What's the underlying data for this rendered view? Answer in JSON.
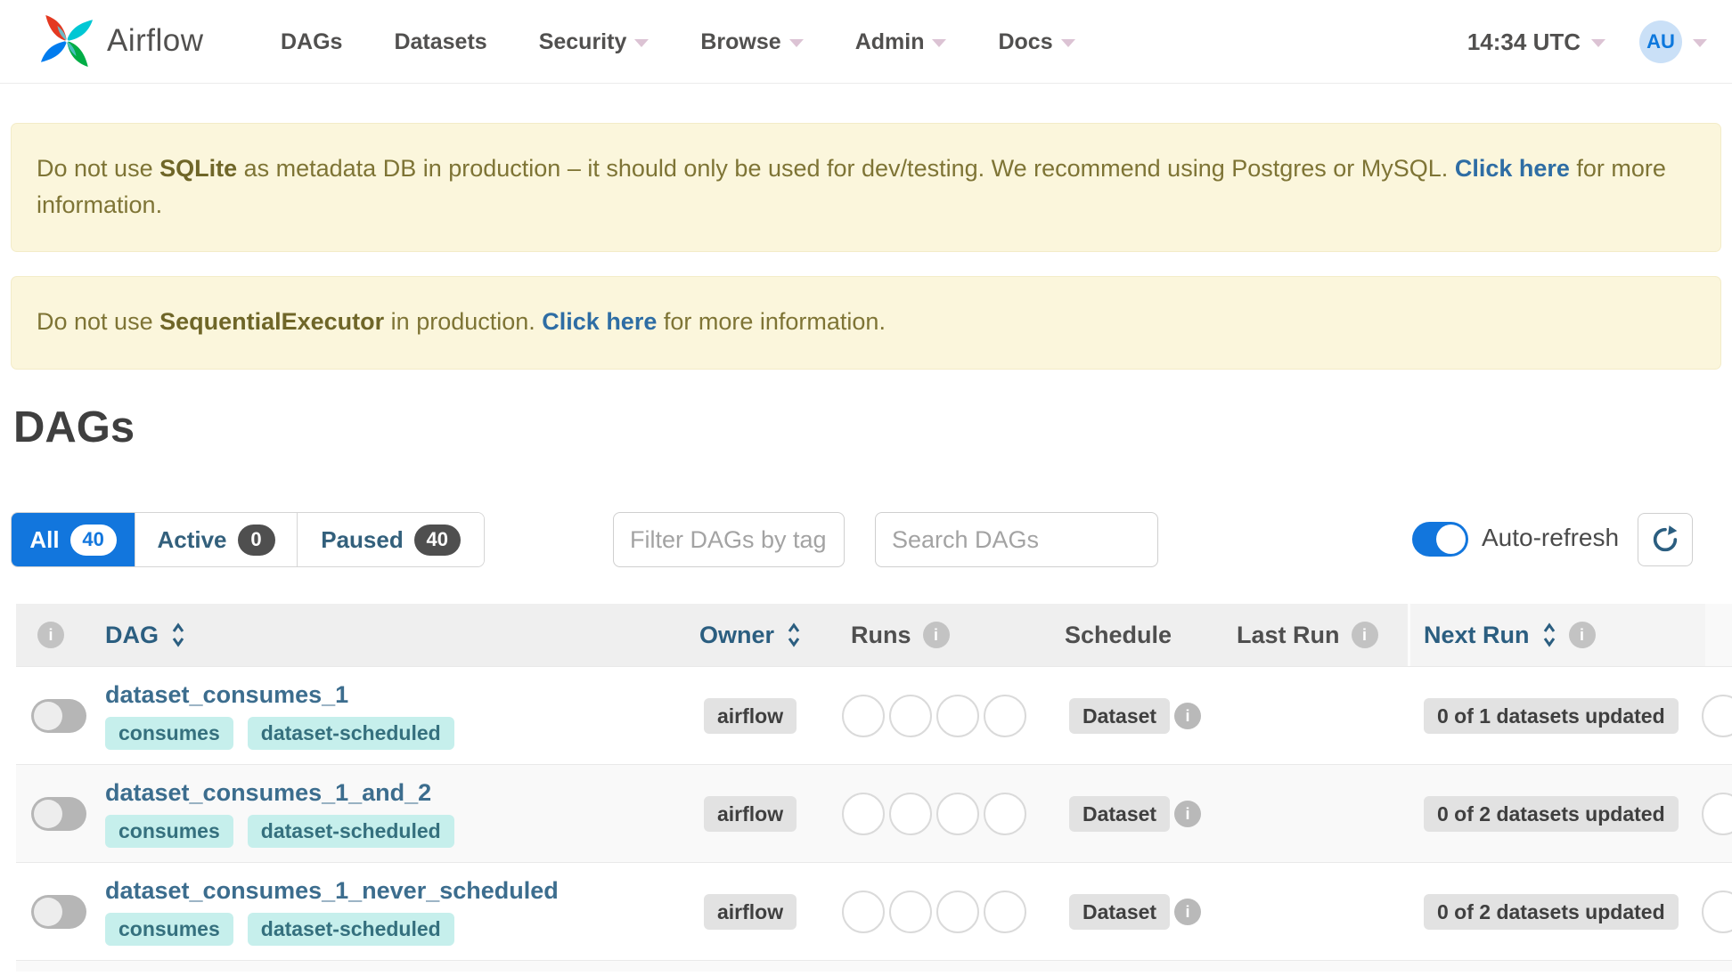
{
  "navbar": {
    "brand": "Airflow",
    "items": [
      {
        "label": "DAGs",
        "caret": false
      },
      {
        "label": "Datasets",
        "caret": false
      },
      {
        "label": "Security",
        "caret": true
      },
      {
        "label": "Browse",
        "caret": true
      },
      {
        "label": "Admin",
        "caret": true
      },
      {
        "label": "Docs",
        "caret": true
      }
    ],
    "clock": "14:34 UTC",
    "avatar_initials": "AU"
  },
  "alerts": [
    {
      "prefix": "Do not use ",
      "strong": "SQLite",
      "middle": " as metadata DB in production – it should only be used for dev/testing. We recommend using Postgres or MySQL. ",
      "link": "Click here",
      "suffix": " for more information."
    },
    {
      "prefix": "Do not use ",
      "strong": "SequentialExecutor",
      "middle": " in production. ",
      "link": "Click here",
      "suffix": " for more information."
    }
  ],
  "page_title": "DAGs",
  "filters": {
    "tabs": [
      {
        "label": "All",
        "count": "40",
        "active": true
      },
      {
        "label": "Active",
        "count": "0",
        "active": false
      },
      {
        "label": "Paused",
        "count": "40",
        "active": false
      }
    ],
    "tag_filter_placeholder": "Filter DAGs by tag",
    "search_placeholder": "Search DAGs",
    "auto_refresh_label": "Auto-refresh",
    "auto_refresh_on": true,
    "refresh_icon": "refresh-circular-arrow"
  },
  "table": {
    "headers": {
      "dag": "DAG",
      "owner": "Owner",
      "runs": "Runs",
      "schedule": "Schedule",
      "last_run": "Last Run",
      "next_run": "Next Run"
    },
    "rows": [
      {
        "name": "dataset_consumes_1",
        "tags": [
          "consumes",
          "dataset-scheduled"
        ],
        "owner": "airflow",
        "schedule": "Dataset",
        "next_run": "0 of 1 datasets updated",
        "paused": true,
        "run_status_circles": 4
      },
      {
        "name": "dataset_consumes_1_and_2",
        "tags": [
          "consumes",
          "dataset-scheduled"
        ],
        "owner": "airflow",
        "schedule": "Dataset",
        "next_run": "0 of 2 datasets updated",
        "paused": true,
        "run_status_circles": 4
      },
      {
        "name": "dataset_consumes_1_never_scheduled",
        "tags": [
          "consumes",
          "dataset-scheduled"
        ],
        "owner": "airflow",
        "schedule": "Dataset",
        "next_run": "0 of 2 datasets updated",
        "paused": true,
        "run_status_circles": 4
      }
    ]
  },
  "colors": {
    "brand_blue": "#1276dd",
    "logo_red": "#e43921",
    "logo_teal": "#00c7d4",
    "logo_green": "#00ad46",
    "logo_blue": "#017cee",
    "alert_bg": "#fbf6dc",
    "alert_text": "#7e7435",
    "alert_link": "#2e6da4",
    "tag_bg": "#c6efec",
    "tag_text": "#35707e",
    "header_sort_link": "#2b5e80",
    "dag_link": "#3c6d8e",
    "badge_gray": "#e2e2e2"
  }
}
